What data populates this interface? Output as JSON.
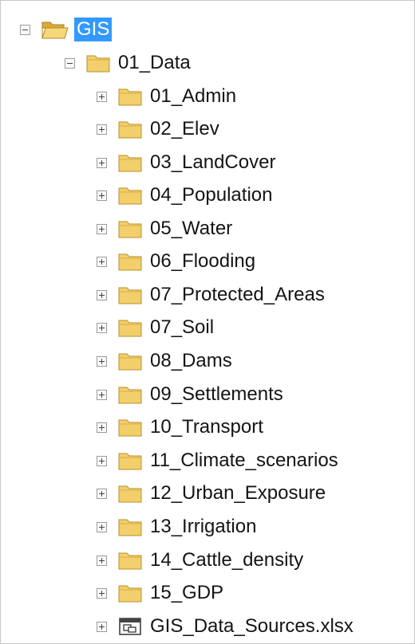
{
  "tree": {
    "root": {
      "label": "GIS",
      "state": "expanded",
      "selected": true,
      "icon": "open-folder-icon"
    },
    "data_folder": {
      "label": "01_Data",
      "state": "expanded",
      "icon": "folder-icon"
    },
    "children": [
      {
        "label": "01_Admin",
        "icon": "folder-icon"
      },
      {
        "label": "02_Elev",
        "icon": "folder-icon"
      },
      {
        "label": "03_LandCover",
        "icon": "folder-icon"
      },
      {
        "label": "04_Population",
        "icon": "folder-icon"
      },
      {
        "label": "05_Water",
        "icon": "folder-icon"
      },
      {
        "label": "06_Flooding",
        "icon": "folder-icon"
      },
      {
        "label": "07_Protected_Areas",
        "icon": "folder-icon"
      },
      {
        "label": "07_Soil",
        "icon": "folder-icon"
      },
      {
        "label": "08_Dams",
        "icon": "folder-icon"
      },
      {
        "label": "09_Settlements",
        "icon": "folder-icon"
      },
      {
        "label": "10_Transport",
        "icon": "folder-icon"
      },
      {
        "label": "11_Climate_scenarios",
        "icon": "folder-icon"
      },
      {
        "label": "12_Urban_Exposure",
        "icon": "folder-icon"
      },
      {
        "label": "13_Irrigation",
        "icon": "folder-icon"
      },
      {
        "label": "14_Cattle_density",
        "icon": "folder-icon"
      },
      {
        "label": "15_GDP",
        "icon": "folder-icon"
      },
      {
        "label": "GIS_Data_Sources.xlsx",
        "icon": "spreadsheet-icon"
      }
    ]
  },
  "colors": {
    "selection": "#3399ff",
    "folder": "#f2cf6b",
    "folder_edge": "#b8902e"
  }
}
